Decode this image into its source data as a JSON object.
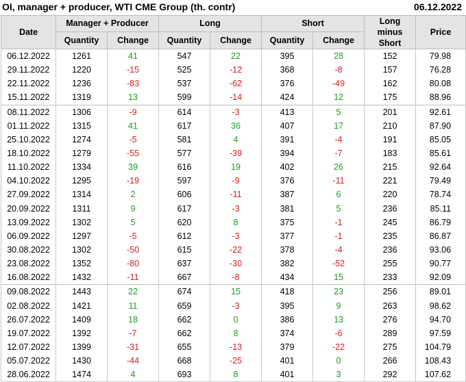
{
  "header": {
    "title": "OI, manager + producer, WTI CME Group (th. contr)",
    "date": "06.12.2022"
  },
  "columns": {
    "date": "Date",
    "group_manager": "Manager + Producer",
    "group_long": "Long",
    "group_short": "Short",
    "long_minus_short": "Long minus Short",
    "price": "Price",
    "quantity": "Quantity",
    "change": "Change"
  },
  "rows": [
    {
      "date": "06.12.2022",
      "mq": "1261",
      "mc": "41",
      "lq": "547",
      "lc": "22",
      "sq": "395",
      "sc": "28",
      "lms": "152",
      "price": "79.98"
    },
    {
      "date": "29.11.2022",
      "mq": "1220",
      "mc": "-15",
      "lq": "525",
      "lc": "-12",
      "sq": "368",
      "sc": "-8",
      "lms": "157",
      "price": "76.28"
    },
    {
      "date": "22.11.2022",
      "mq": "1236",
      "mc": "-83",
      "lq": "537",
      "lc": "-62",
      "sq": "376",
      "sc": "-49",
      "lms": "162",
      "price": "80.08"
    },
    {
      "date": "15.11.2022",
      "mq": "1319",
      "mc": "13",
      "lq": "599",
      "lc": "-14",
      "sq": "424",
      "sc": "12",
      "lms": "175",
      "price": "88.96"
    },
    {
      "date": "08.11.2022",
      "mq": "1306",
      "mc": "-9",
      "lq": "614",
      "lc": "-3",
      "sq": "413",
      "sc": "5",
      "lms": "201",
      "price": "92.61"
    },
    {
      "date": "01.11.2022",
      "mq": "1315",
      "mc": "41",
      "lq": "617",
      "lc": "36",
      "sq": "407",
      "sc": "17",
      "lms": "210",
      "price": "87.90"
    },
    {
      "date": "25.10.2022",
      "mq": "1274",
      "mc": "-5",
      "lq": "581",
      "lc": "4",
      "sq": "391",
      "sc": "-4",
      "lms": "191",
      "price": "85.05"
    },
    {
      "date": "18.10.2022",
      "mq": "1279",
      "mc": "-55",
      "lq": "577",
      "lc": "-39",
      "sq": "394",
      "sc": "-7",
      "lms": "183",
      "price": "85.61"
    },
    {
      "date": "11.10.2022",
      "mq": "1334",
      "mc": "39",
      "lq": "616",
      "lc": "19",
      "sq": "402",
      "sc": "26",
      "lms": "215",
      "price": "92.64"
    },
    {
      "date": "04.10.2022",
      "mq": "1295",
      "mc": "-19",
      "lq": "597",
      "lc": "-9",
      "sq": "376",
      "sc": "-11",
      "lms": "221",
      "price": "79.49"
    },
    {
      "date": "27.09.2022",
      "mq": "1314",
      "mc": "2",
      "lq": "606",
      "lc": "-11",
      "sq": "387",
      "sc": "6",
      "lms": "220",
      "price": "78.74"
    },
    {
      "date": "20.09.2022",
      "mq": "1311",
      "mc": "9",
      "lq": "617",
      "lc": "-3",
      "sq": "381",
      "sc": "5",
      "lms": "236",
      "price": "85.11"
    },
    {
      "date": "13.09.2022",
      "mq": "1302",
      "mc": "5",
      "lq": "620",
      "lc": "8",
      "sq": "375",
      "sc": "-1",
      "lms": "245",
      "price": "86.79"
    },
    {
      "date": "06.09.2022",
      "mq": "1297",
      "mc": "-5",
      "lq": "612",
      "lc": "-3",
      "sq": "377",
      "sc": "-1",
      "lms": "235",
      "price": "86.87"
    },
    {
      "date": "30.08.2022",
      "mq": "1302",
      "mc": "-50",
      "lq": "615",
      "lc": "-22",
      "sq": "378",
      "sc": "-4",
      "lms": "236",
      "price": "93.06"
    },
    {
      "date": "23.08.2022",
      "mq": "1352",
      "mc": "-80",
      "lq": "637",
      "lc": "-30",
      "sq": "382",
      "sc": "-52",
      "lms": "255",
      "price": "90.77"
    },
    {
      "date": "16.08.2022",
      "mq": "1432",
      "mc": "-11",
      "lq": "667",
      "lc": "-8",
      "sq": "434",
      "sc": "15",
      "lms": "233",
      "price": "92.09"
    },
    {
      "date": "09.08.2022",
      "mq": "1443",
      "mc": "22",
      "lq": "674",
      "lc": "15",
      "sq": "418",
      "sc": "23",
      "lms": "256",
      "price": "89.01"
    },
    {
      "date": "02.08.2022",
      "mq": "1421",
      "mc": "11",
      "lq": "659",
      "lc": "-3",
      "sq": "395",
      "sc": "9",
      "lms": "263",
      "price": "98.62"
    },
    {
      "date": "26.07.2022",
      "mq": "1409",
      "mc": "18",
      "lq": "662",
      "lc": "0",
      "sq": "386",
      "sc": "13",
      "lms": "276",
      "price": "94.70"
    },
    {
      "date": "19.07.2022",
      "mq": "1392",
      "mc": "-7",
      "lq": "662",
      "lc": "8",
      "sq": "374",
      "sc": "-6",
      "lms": "289",
      "price": "97.59"
    },
    {
      "date": "12.07.2022",
      "mq": "1399",
      "mc": "-31",
      "lq": "655",
      "lc": "-13",
      "sq": "379",
      "sc": "-22",
      "lms": "275",
      "price": "104.79"
    },
    {
      "date": "05.07.2022",
      "mq": "1430",
      "mc": "-44",
      "lq": "668",
      "lc": "-25",
      "sq": "401",
      "sc": "0",
      "lms": "266",
      "price": "108.43"
    },
    {
      "date": "28.06.2022",
      "mq": "1474",
      "mc": "4",
      "lq": "693",
      "lc": "8",
      "sq": "401",
      "sc": "3",
      "lms": "292",
      "price": "107.62"
    }
  ],
  "colors": {
    "positive": "#1e9a1e",
    "negative": "#d42020",
    "header_bg": "#e4e4e4"
  }
}
